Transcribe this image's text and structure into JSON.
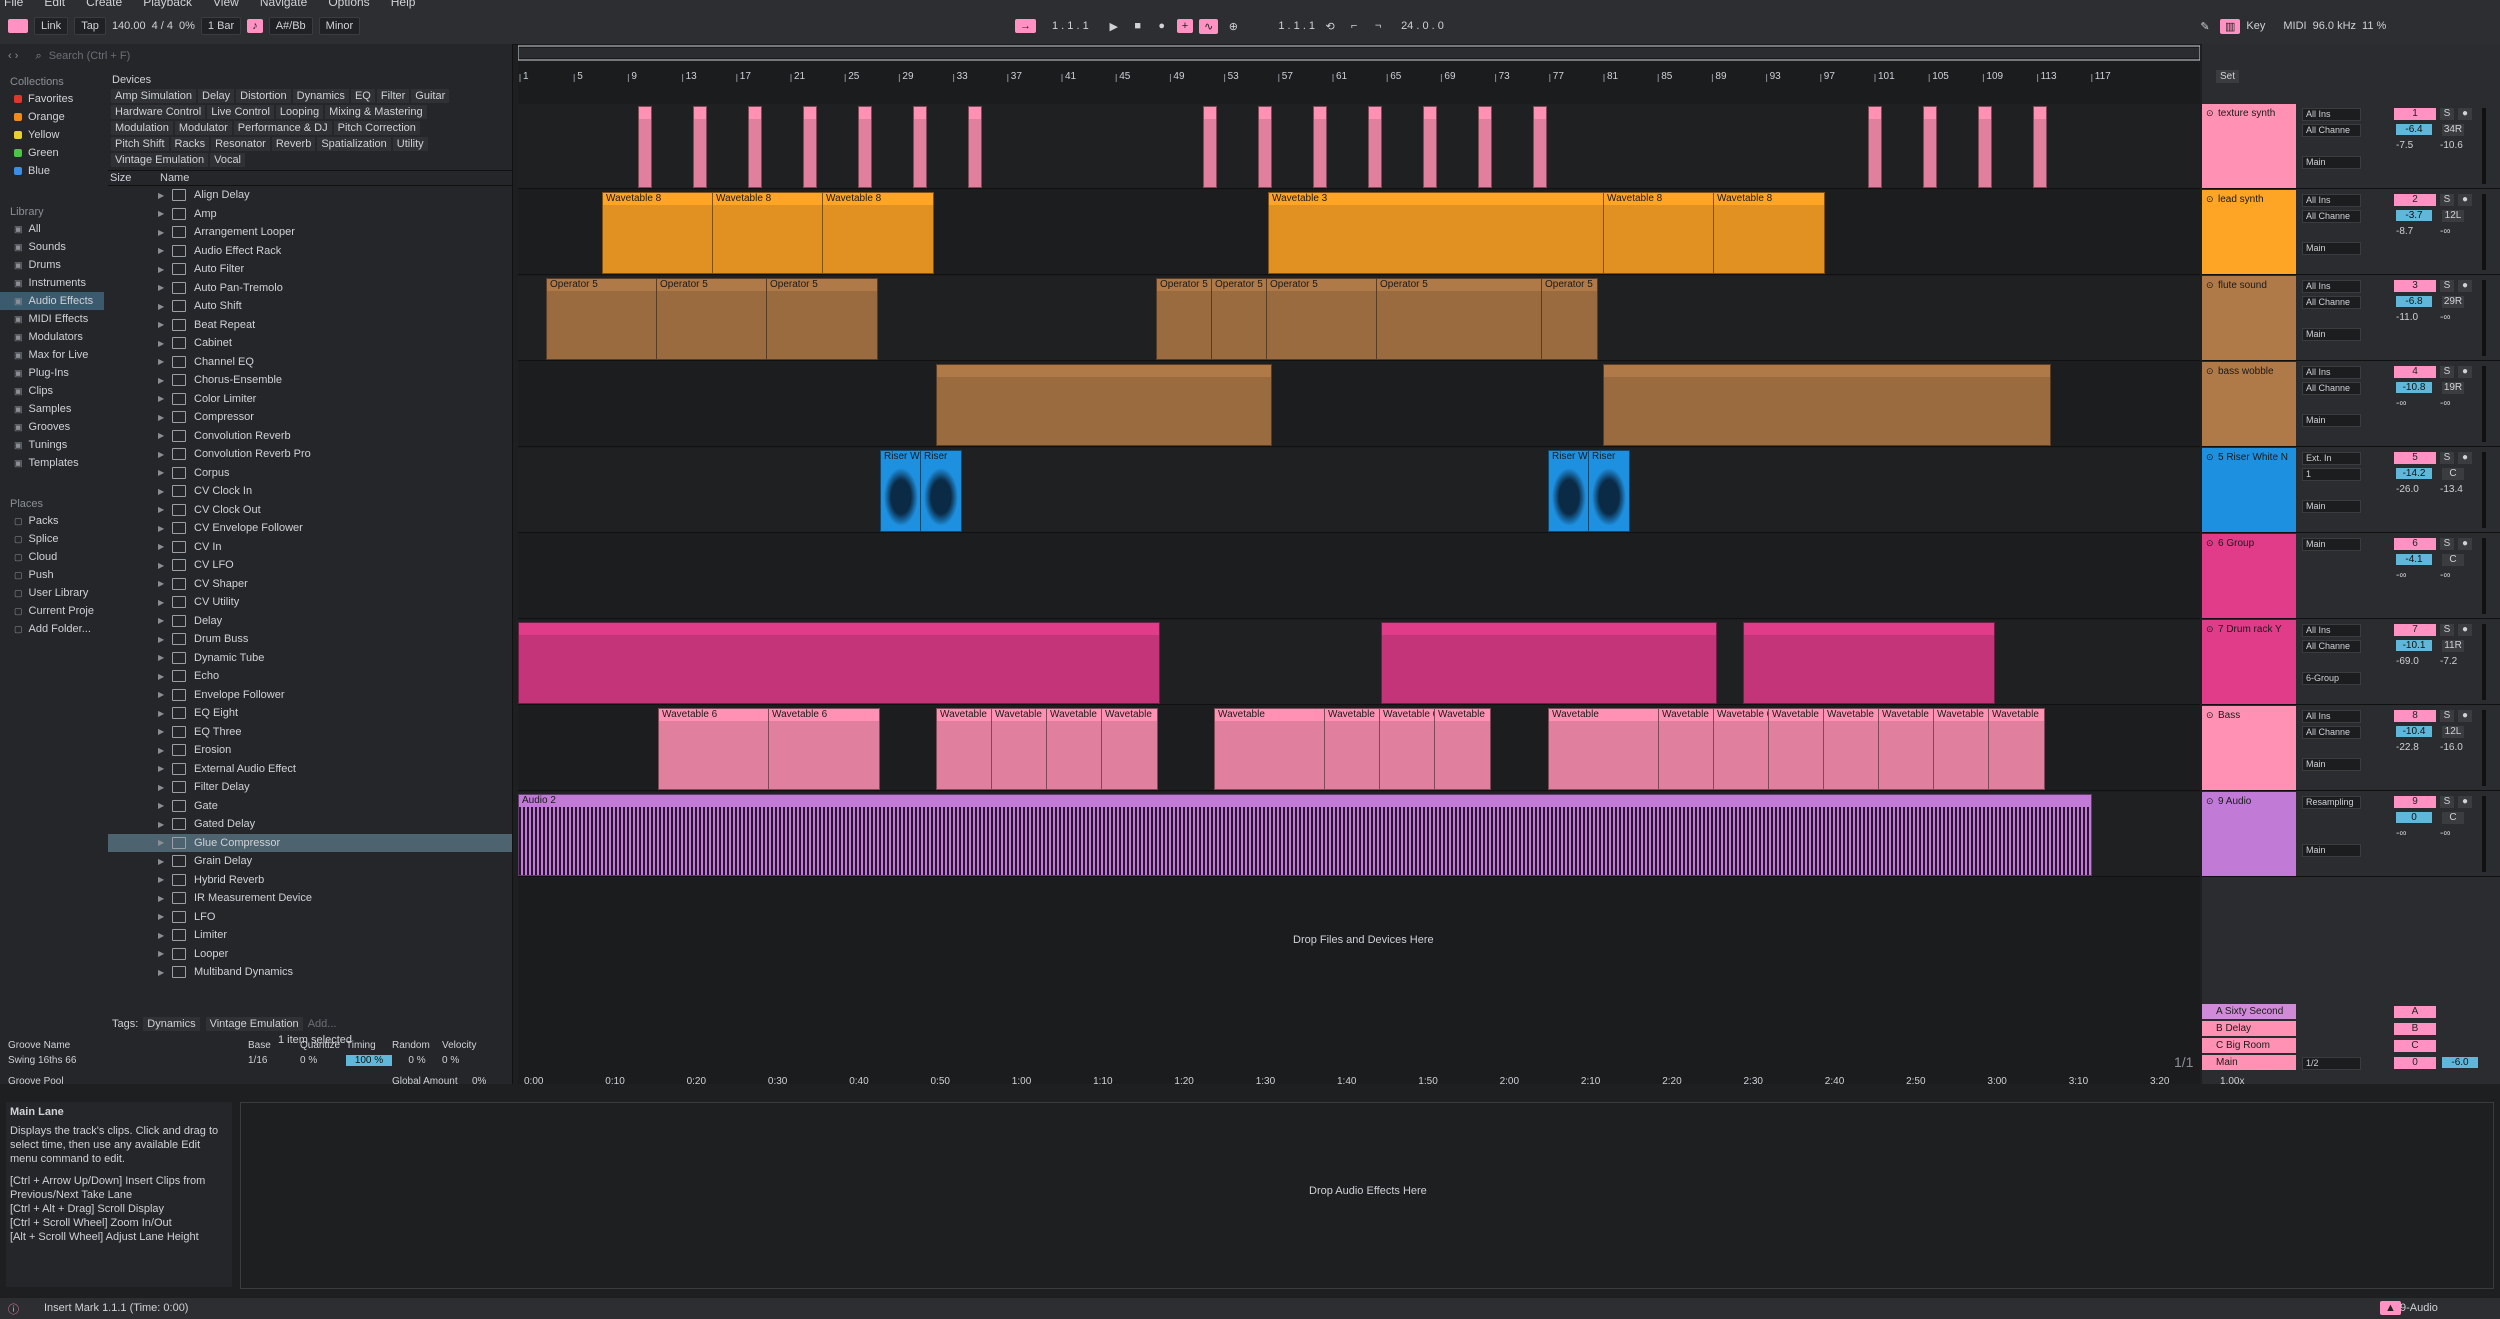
{
  "menu": [
    "File",
    "Edit",
    "Create",
    "Playback",
    "View",
    "Navigate",
    "Options",
    "Help"
  ],
  "transport": {
    "link": "Link",
    "tap": "Tap",
    "tempo": "140.00",
    "meter": "4 / 4",
    "swing": "0%",
    "quant": "1 Bar",
    "key": "A#/Bb",
    "scale": "Minor",
    "position": "1 .  1 .  1",
    "loop_start": "1 .  1 .  1",
    "loop_len": "24 .  0 .  0",
    "key_label": "Key",
    "midi": "MIDI",
    "samplerate": "96.0 kHz",
    "cpu": "11 %"
  },
  "browser": {
    "collections_title": "Collections",
    "collections": [
      {
        "name": "Favorites",
        "color": "#e0362b"
      },
      {
        "name": "Orange",
        "color": "#f08a1a"
      },
      {
        "name": "Yellow",
        "color": "#e8d030"
      },
      {
        "name": "Green",
        "color": "#4ec34a"
      },
      {
        "name": "Blue",
        "color": "#3a8ee6"
      }
    ],
    "library_title": "Library",
    "library": [
      "All",
      "Sounds",
      "Drums",
      "Instruments",
      "Audio Effects",
      "MIDI Effects",
      "Modulators",
      "Max for Live",
      "Plug-Ins",
      "Clips",
      "Samples",
      "Grooves",
      "Tunings",
      "Templates"
    ],
    "places_title": "Places",
    "places": [
      "Packs",
      "Splice",
      "Cloud",
      "Push",
      "User Library",
      "Current Proje",
      "Add Folder..."
    ],
    "search_placeholder": "Search (Ctrl + F)",
    "devices_label": "Devices",
    "tags": [
      "Amp Simulation",
      "Delay",
      "Distortion",
      "Dynamics",
      "EQ",
      "Filter",
      "Guitar",
      "Hardware Control",
      "Live Control",
      "Looping",
      "Mixing & Mastering",
      "Modulation",
      "Modulator",
      "Performance & DJ",
      "Pitch Correction",
      "Pitch Shift",
      "Racks",
      "Resonator",
      "Reverb",
      "Spatialization",
      "Utility",
      "Vintage Emulation",
      "Vocal"
    ],
    "col_size": "Size",
    "col_name": "Name",
    "items": [
      "Align Delay",
      "Amp",
      "Arrangement Looper",
      "Audio Effect Rack",
      "Auto Filter",
      "Auto Pan-Tremolo",
      "Auto Shift",
      "Beat Repeat",
      "Cabinet",
      "Channel EQ",
      "Chorus-Ensemble",
      "Color Limiter",
      "Compressor",
      "Convolution Reverb",
      "Convolution Reverb Pro",
      "Corpus",
      "CV Clock In",
      "CV Clock Out",
      "CV Envelope Follower",
      "CV In",
      "CV LFO",
      "CV Shaper",
      "CV Utility",
      "Delay",
      "Drum Buss",
      "Dynamic Tube",
      "Echo",
      "Envelope Follower",
      "EQ Eight",
      "EQ Three",
      "Erosion",
      "External Audio Effect",
      "Filter Delay",
      "Gate",
      "Gated Delay",
      "Glue Compressor",
      "Grain Delay",
      "Hybrid Reverb",
      "IR Measurement Device",
      "LFO",
      "Limiter",
      "Looper",
      "Multiband Dynamics"
    ],
    "selected_item": "Glue Compressor",
    "footer_tags_label": "Tags:",
    "footer_tags": [
      "Dynamics",
      "Vintage Emulation",
      "Add..."
    ],
    "selection_count": "1 item selected"
  },
  "groove": {
    "headers": [
      "Groove Name",
      "Base",
      "Quantize",
      "Timing",
      "Random",
      "Velocity"
    ],
    "row": {
      "name": "Swing 16ths 66",
      "base": "1/16",
      "quantize": "0 %",
      "timing": "100 %",
      "random": "0 %",
      "velocity": "0 %"
    },
    "pool_label": "Groove Pool",
    "global_label": "Global Amount",
    "global_value": "0%"
  },
  "info": {
    "title": "Main Lane",
    "text": "Displays the track's clips. Click and drag to select time, then use any available Edit menu command to edit.",
    "shortcuts": [
      "[Ctrl + Arrow Up/Down] Insert Clips from Previous/Next Take Lane",
      "[Ctrl + Alt + Drag] Scroll Display",
      "[Ctrl + Scroll Wheel] Zoom In/Out",
      "[Alt + Scroll Wheel] Adjust Lane Height"
    ]
  },
  "ruler": {
    "bars": [
      "1",
      "5",
      "9",
      "13",
      "17",
      "21",
      "25",
      "29",
      "33",
      "37",
      "41",
      "45",
      "49",
      "53",
      "57",
      "61",
      "65",
      "69",
      "73",
      "77",
      "81",
      "85",
      "89",
      "93",
      "97",
      "101",
      "105",
      "109",
      "113",
      "117"
    ],
    "times": [
      "0:00",
      "0:10",
      "0:20",
      "0:30",
      "0:40",
      "0:50",
      "1:00",
      "1:10",
      "1:20",
      "1:30",
      "1:40",
      "1:50",
      "2:00",
      "2:10",
      "2:20",
      "2:30",
      "2:40",
      "2:50",
      "3:00",
      "3:10",
      "3:20"
    ]
  },
  "set_label": "Set",
  "drop_files": "Drop Files and Devices Here",
  "drop_effects": "Drop Audio Effects Here",
  "page_counter": "1/1",
  "zoom": "1.00x",
  "tracks": [
    {
      "name": "texture synth",
      "color": "#ff92b4",
      "num": "1",
      "in": "All Ins",
      "ch": "All Channe",
      "vol": "-6.4",
      "pan": "34R",
      "v2": "-7.5",
      "v3": "-10.6",
      "out": "Main",
      "clips": []
    },
    {
      "name": "lead synth",
      "color": "#ffa526",
      "num": "2",
      "in": "All Ins",
      "ch": "All Channe",
      "vol": "-3.7",
      "pan": "12L",
      "v2": "-8.7",
      "v3": "-∞",
      "out": "Main",
      "clips": [
        "Wavetable 8",
        "Wavetable 8",
        "Wavetable 8",
        "Wavetable 3",
        "Wavetable 8",
        "Wavetable 8"
      ]
    },
    {
      "name": "flute sound",
      "color": "#b07a48",
      "num": "3",
      "in": "All Ins",
      "ch": "All Channe",
      "vol": "-6.8",
      "pan": "29R",
      "v2": "-11.0",
      "v3": "-∞",
      "out": "Main",
      "clips": [
        "Operator 5",
        "Operator 5",
        "Operator 5",
        "Operator 5",
        "Operator 5",
        "Operator 5",
        "Operator 5",
        "Operator 5"
      ]
    },
    {
      "name": "bass wobble",
      "color": "#b07a48",
      "num": "4",
      "in": "All Ins",
      "ch": "All Channe",
      "vol": "-10.8",
      "pan": "19R",
      "v2": "-∞",
      "v3": "-∞",
      "out": "Main",
      "clips": []
    },
    {
      "name": "5 Riser White N",
      "color": "#1e90e0",
      "num": "5",
      "in": "Ext. In",
      "ch": "1",
      "vol": "-14.2",
      "pan": "C",
      "v2": "-26.0",
      "v3": "-13.4",
      "out": "Main",
      "clips": [
        "Riser White",
        "Riser",
        "Riser White",
        "Riser"
      ]
    },
    {
      "name": "6 Group",
      "color": "#e03c8a",
      "num": "6",
      "in": "Main",
      "ch": "",
      "vol": "-4.1",
      "pan": "C",
      "v2": "-∞",
      "v3": "-∞",
      "out": "",
      "clips": []
    },
    {
      "name": "7 Drum rack Y",
      "color": "#e03c8a",
      "num": "7",
      "in": "All Ins",
      "ch": "All Channe",
      "vol": "-10.1",
      "pan": "11R",
      "v2": "-69.0",
      "v3": "-7.2",
      "out": "6-Group",
      "clips": []
    },
    {
      "name": "Bass",
      "color": "#ff92b4",
      "num": "8",
      "in": "All Ins",
      "ch": "All Channe",
      "vol": "-10.4",
      "pan": "12L",
      "v2": "-22.8",
      "v3": "-16.0",
      "out": "Main",
      "clips": [
        "Wavetable 6",
        "Wavetable 6",
        "Wavetable",
        "Wavetable",
        "Wavetable",
        "Wavetable",
        "Wavetable",
        "Wavetable",
        "Wavetable 6",
        "Wavetable",
        "Wavetable",
        "Wavetable",
        "Wavetable 6",
        "Wavetable",
        "Wavetable",
        "Wavetable",
        "Wavetable",
        "Wavetable",
        "Wavetable",
        "Wavetable"
      ]
    },
    {
      "name": "9 Audio",
      "color": "#c17bd6",
      "num": "9",
      "in": "Resampling",
      "ch": "",
      "vol": "0",
      "pan": "C",
      "v2": "-∞",
      "v3": "-∞",
      "out": "Main",
      "clips": [
        "Audio 2"
      ]
    }
  ],
  "returns": [
    {
      "name": "A Sixty Second",
      "color": "#d08ad8",
      "letter": "A"
    },
    {
      "name": "B Delay",
      "color": "#ff92b4",
      "letter": "B"
    },
    {
      "name": "C Big Room",
      "color": "#ff92b4",
      "letter": "C"
    },
    {
      "name": "Main",
      "color": "#ff92b4",
      "letter": "0",
      "vol": "-6.0",
      "div": "1/2"
    }
  ],
  "status": {
    "text": "Insert Mark 1.1.1 (Time: 0:00)",
    "track": "9-Audio"
  }
}
